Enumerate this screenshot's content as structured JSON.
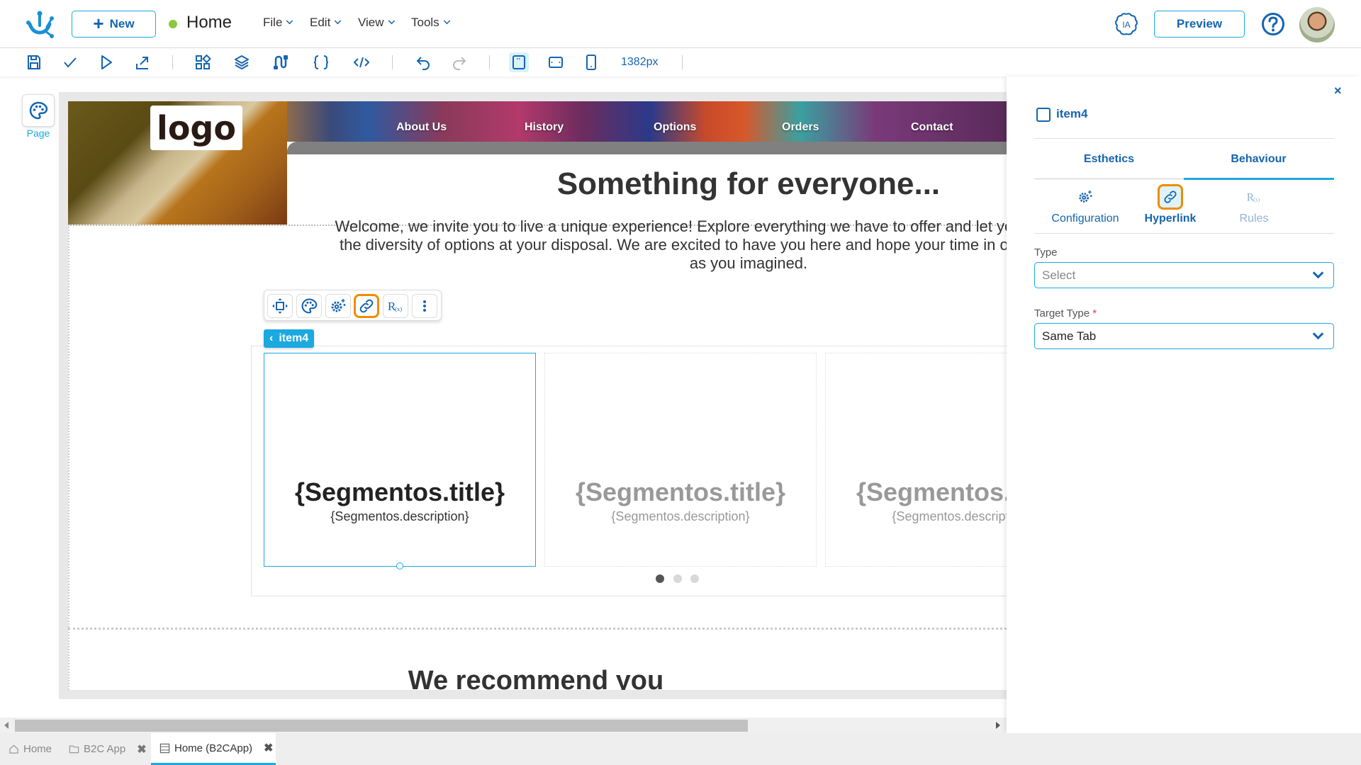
{
  "header": {
    "new_label": "New",
    "page_name": "Home",
    "status_color": "#8dc63f",
    "menus": [
      {
        "label": "File"
      },
      {
        "label": "Edit"
      },
      {
        "label": "View"
      },
      {
        "label": "Tools"
      }
    ],
    "ia_label": "IA",
    "preview_label": "Preview"
  },
  "toolbar": {
    "icons": [
      "save-icon",
      "check-icon",
      "play-icon",
      "export-icon",
      "components-icon",
      "layers-icon",
      "connections-icon",
      "braces-icon",
      "code-icon",
      "undo-icon",
      "redo-icon",
      "desktop-icon",
      "tablet-icon",
      "mobile-icon"
    ],
    "width_readout": "1382px"
  },
  "sidebar": {
    "page_label": "Page"
  },
  "canvas": {
    "logo_text": "logo",
    "nav": [
      "About Us",
      "History",
      "Options",
      "Orders",
      "Contact"
    ],
    "hero_title": "Something for everyone...",
    "hero_text": "Welcome, we invite you to live a unique experience! Explore everything we have to offer and let yourself be surprised by the diversity of options at your disposal. We are excited to have you here and hope your time in our space is as special as you imagined.",
    "selected_item": "item4",
    "cards": [
      {
        "title": "{Segmentos.title}",
        "description": "{Segmentos.description}"
      },
      {
        "title": "{Segmentos.title}",
        "description": "{Segmentos.description}"
      },
      {
        "title": "{Segmentos.title}",
        "description": "{Segmentos.description}"
      }
    ],
    "carousel_active_dot": 1,
    "carousel_dots": 3,
    "recommend_title": "We recommend you"
  },
  "panel": {
    "close_label": "×",
    "item_name": "item4",
    "tabs": [
      {
        "label": "Esthetics",
        "active": false
      },
      {
        "label": "Behaviour",
        "active": true
      }
    ],
    "subtabs": [
      {
        "label": "Configuration",
        "active": false
      },
      {
        "label": "Hyperlink",
        "active": true
      },
      {
        "label": "Rules",
        "active": false
      }
    ],
    "fields": {
      "type_label": "Type",
      "type_placeholder": "Select",
      "target_type_label": "Target Type",
      "target_type_required": "*",
      "target_type_value": "Same Tab"
    }
  },
  "bottom_tabs": [
    {
      "label": "Home",
      "icon": "home-icon",
      "closable": false,
      "active": false
    },
    {
      "label": "B2C App",
      "icon": "folder-icon",
      "closable": true,
      "active": false
    },
    {
      "label": "Home (B2CApp)",
      "icon": "page-icon",
      "closable": true,
      "active": true
    }
  ],
  "colors": {
    "primary": "#1565b0",
    "accent": "#1ba9e0",
    "highlight": "#f08c00"
  }
}
